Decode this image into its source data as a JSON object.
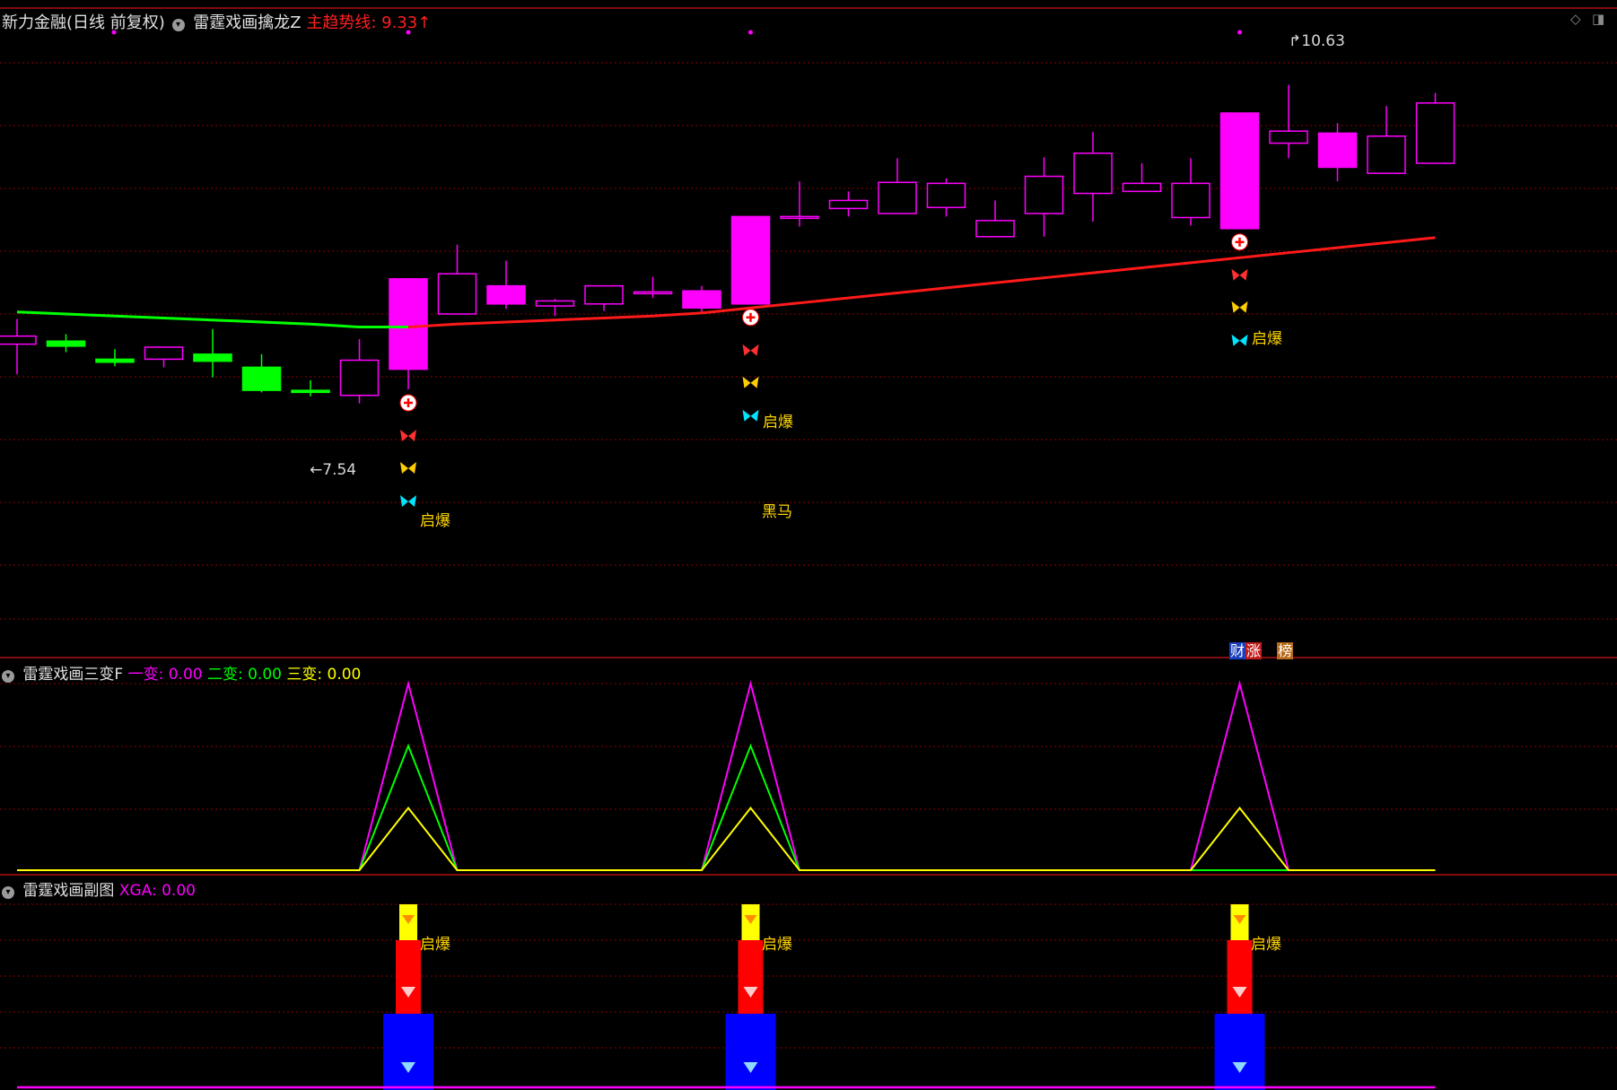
{
  "colors": {
    "background": "#000000",
    "grid": "#8b0000",
    "up": "#ff00ff",
    "down": "#00ff00",
    "trend_up": "#ff1a1a",
    "trend_down": "#00ff00",
    "yellow": "#ffff00",
    "cyan": "#00ffff",
    "blue": "#0000ff",
    "white": "#ffffff"
  },
  "header": {
    "title": "新力金融(日线 前复权)",
    "indicator": "雷霆戏画擒龙Z",
    "trend_label": "主趋势线: 9.33",
    "trend_arrow": "↑"
  },
  "main_chart": {
    "max_label": "10.63",
    "min_label": "7.54",
    "signal_text": "启爆",
    "dark_horse_text": "黑马",
    "badge_cai": "财",
    "badge_zhang": "涨",
    "badge_bang": "榜"
  },
  "panel2": {
    "name": "雷霆戏画三变F",
    "s1": "一变: 0.00",
    "s2": "二变: 0.00",
    "s3": "三变: 0.00"
  },
  "panel3": {
    "name": "雷霆戏画副图",
    "xga": "XGA: 0.00",
    "signal_text": "启爆"
  },
  "chart_data": [
    {
      "type": "candlestick",
      "ylim": [
        6.0,
        11.0
      ],
      "candles": [
        {
          "o": 8.2,
          "c": 8.28,
          "h": 8.45,
          "l": 7.9
        },
        {
          "o": 8.23,
          "c": 8.18,
          "h": 8.3,
          "l": 8.12
        },
        {
          "o": 8.05,
          "c": 8.02,
          "h": 8.15,
          "l": 7.98
        },
        {
          "o": 8.05,
          "c": 8.17,
          "h": 8.17,
          "l": 7.97
        },
        {
          "o": 8.1,
          "c": 8.03,
          "h": 8.35,
          "l": 7.87
        },
        {
          "o": 7.97,
          "c": 7.74,
          "h": 8.1,
          "l": 7.72
        },
        {
          "o": 7.74,
          "c": 7.72,
          "h": 7.84,
          "l": 7.68
        },
        {
          "o": 7.69,
          "c": 8.04,
          "h": 8.25,
          "l": 7.61
        },
        {
          "o": 7.95,
          "c": 8.85,
          "h": 8.85,
          "l": 7.75
        },
        {
          "o": 8.5,
          "c": 8.9,
          "h": 9.19,
          "l": 8.5
        },
        {
          "o": 8.6,
          "c": 8.78,
          "h": 9.03,
          "l": 8.55
        },
        {
          "o": 8.58,
          "c": 8.63,
          "h": 8.65,
          "l": 8.48
        },
        {
          "o": 8.6,
          "c": 8.78,
          "h": 8.78,
          "l": 8.53
        },
        {
          "o": 8.72,
          "c": 8.72,
          "h": 8.87,
          "l": 8.66
        },
        {
          "o": 8.56,
          "c": 8.73,
          "h": 8.78,
          "l": 8.51
        },
        {
          "o": 8.6,
          "c": 9.47,
          "h": 9.47,
          "l": 8.6
        },
        {
          "o": 9.47,
          "c": 9.47,
          "h": 9.82,
          "l": 9.37
        },
        {
          "o": 9.55,
          "c": 9.63,
          "h": 9.72,
          "l": 9.47
        },
        {
          "o": 9.5,
          "c": 9.81,
          "h": 10.05,
          "l": 9.5
        },
        {
          "o": 9.56,
          "c": 9.8,
          "h": 9.85,
          "l": 9.47
        },
        {
          "o": 9.27,
          "c": 9.43,
          "h": 9.63,
          "l": 9.27
        },
        {
          "o": 9.5,
          "c": 9.87,
          "h": 10.06,
          "l": 9.27
        },
        {
          "o": 9.7,
          "c": 10.1,
          "h": 10.31,
          "l": 9.42
        },
        {
          "o": 9.72,
          "c": 9.8,
          "h": 10.0,
          "l": 9.72
        },
        {
          "o": 9.46,
          "c": 9.8,
          "h": 10.05,
          "l": 9.38
        },
        {
          "o": 9.35,
          "c": 10.5,
          "h": 10.5,
          "l": 9.35
        },
        {
          "o": 10.2,
          "c": 10.32,
          "h": 10.78,
          "l": 10.05
        },
        {
          "o": 9.96,
          "c": 10.3,
          "h": 10.4,
          "l": 9.82
        },
        {
          "o": 9.9,
          "c": 10.27,
          "h": 10.57,
          "l": 9.9
        },
        {
          "o": 10.0,
          "c": 10.6,
          "h": 10.7,
          "l": 10.0
        }
      ],
      "trend_line": [
        8.52,
        8.5,
        8.48,
        8.46,
        8.44,
        8.42,
        8.4,
        8.37,
        8.37,
        8.4,
        8.42,
        8.44,
        8.46,
        8.48,
        8.51,
        8.56,
        8.61,
        8.66,
        8.71,
        8.76,
        8.81,
        8.86,
        8.91,
        8.96,
        9.01,
        9.06,
        9.11,
        9.16,
        9.21,
        9.26
      ],
      "trend_up_from_index": 8,
      "signal_indices": [
        8,
        15,
        25
      ],
      "dark_horse_index": 15,
      "max_index": 26,
      "min_index": 6
    },
    {
      "type": "line",
      "ylim": [
        0,
        3
      ],
      "series": [
        {
          "name": "一变",
          "color": "#ff00ff",
          "values": [
            0,
            0,
            0,
            0,
            0,
            0,
            0,
            0,
            3,
            0,
            0,
            0,
            0,
            0,
            0,
            3,
            0,
            0,
            0,
            0,
            0,
            0,
            0,
            0,
            0,
            3,
            0,
            0,
            0,
            0
          ]
        },
        {
          "name": "二变",
          "color": "#00ff00",
          "values": [
            0,
            0,
            0,
            0,
            0,
            0,
            0,
            0,
            2,
            0,
            0,
            0,
            0,
            0,
            0,
            2,
            0,
            0,
            0,
            0,
            0,
            0,
            0,
            0,
            0,
            0,
            0,
            0,
            0,
            0
          ]
        },
        {
          "name": "三变",
          "color": "#ffff00",
          "values": [
            0,
            0,
            0,
            0,
            0,
            0,
            0,
            0,
            1,
            0,
            0,
            0,
            0,
            0,
            0,
            1,
            0,
            0,
            0,
            0,
            0,
            0,
            0,
            0,
            0,
            1,
            0,
            0,
            0,
            0
          ]
        }
      ]
    },
    {
      "type": "bar",
      "series": [
        {
          "name": "XGA",
          "values": [
            0,
            0,
            0,
            0,
            0,
            0,
            0,
            0,
            1,
            0,
            0,
            0,
            0,
            0,
            0,
            1,
            0,
            0,
            0,
            0,
            0,
            0,
            0,
            0,
            0,
            1,
            0,
            0,
            0,
            0
          ]
        }
      ]
    }
  ]
}
